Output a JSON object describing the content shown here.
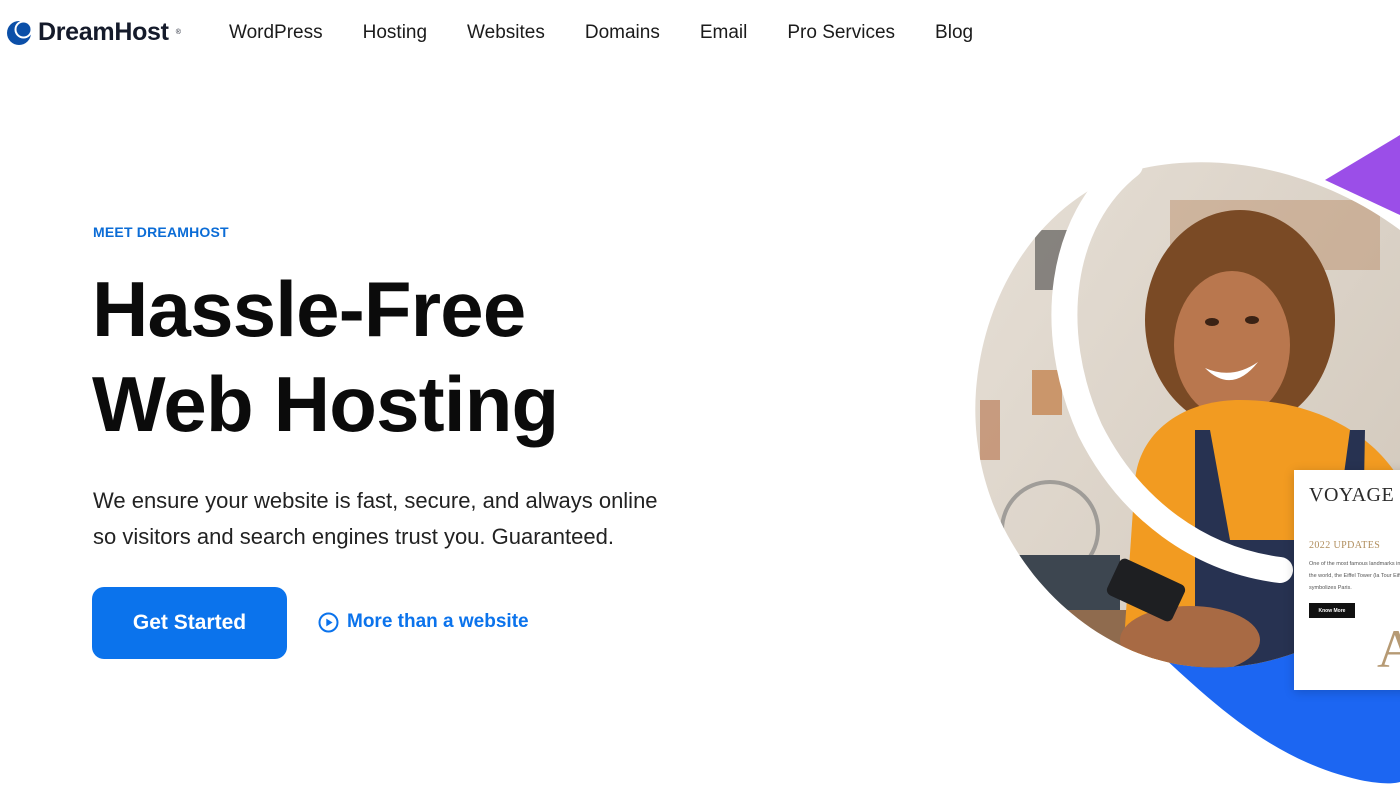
{
  "brand": {
    "name": "DreamHost",
    "registered_mark": "®",
    "color": "#0b4fa8"
  },
  "nav": {
    "items": [
      {
        "label": "WordPress"
      },
      {
        "label": "Hosting"
      },
      {
        "label": "Websites"
      },
      {
        "label": "Domains"
      },
      {
        "label": "Email"
      },
      {
        "label": "Pro Services"
      },
      {
        "label": "Blog"
      }
    ]
  },
  "hero": {
    "eyebrow": "MEET DREAMHOST",
    "headline_line1": "Hassle-Free",
    "headline_line2": "Web Hosting",
    "sub_line1": "We ensure your website is fast, secure, and always online",
    "sub_line2": "so visitors and search engines trust you. Guaranteed.",
    "cta_label": "Get Started",
    "video_link_label": "More than a website",
    "video_icon": "play-circle-icon"
  },
  "preview_card": {
    "title": "VOYAGE",
    "updates": "2022 UPDATES",
    "body": "One of the most famous landmarks in the world, the Eiffel Tower (la Tour Eiffel) symbolizes Paris.",
    "button": "Know More",
    "letter": "A"
  },
  "colors": {
    "accent": "#0b73ec",
    "eyebrow": "#0b6cd6",
    "purple": "#9b4ee8",
    "blob_blue": "#1c66f2"
  }
}
